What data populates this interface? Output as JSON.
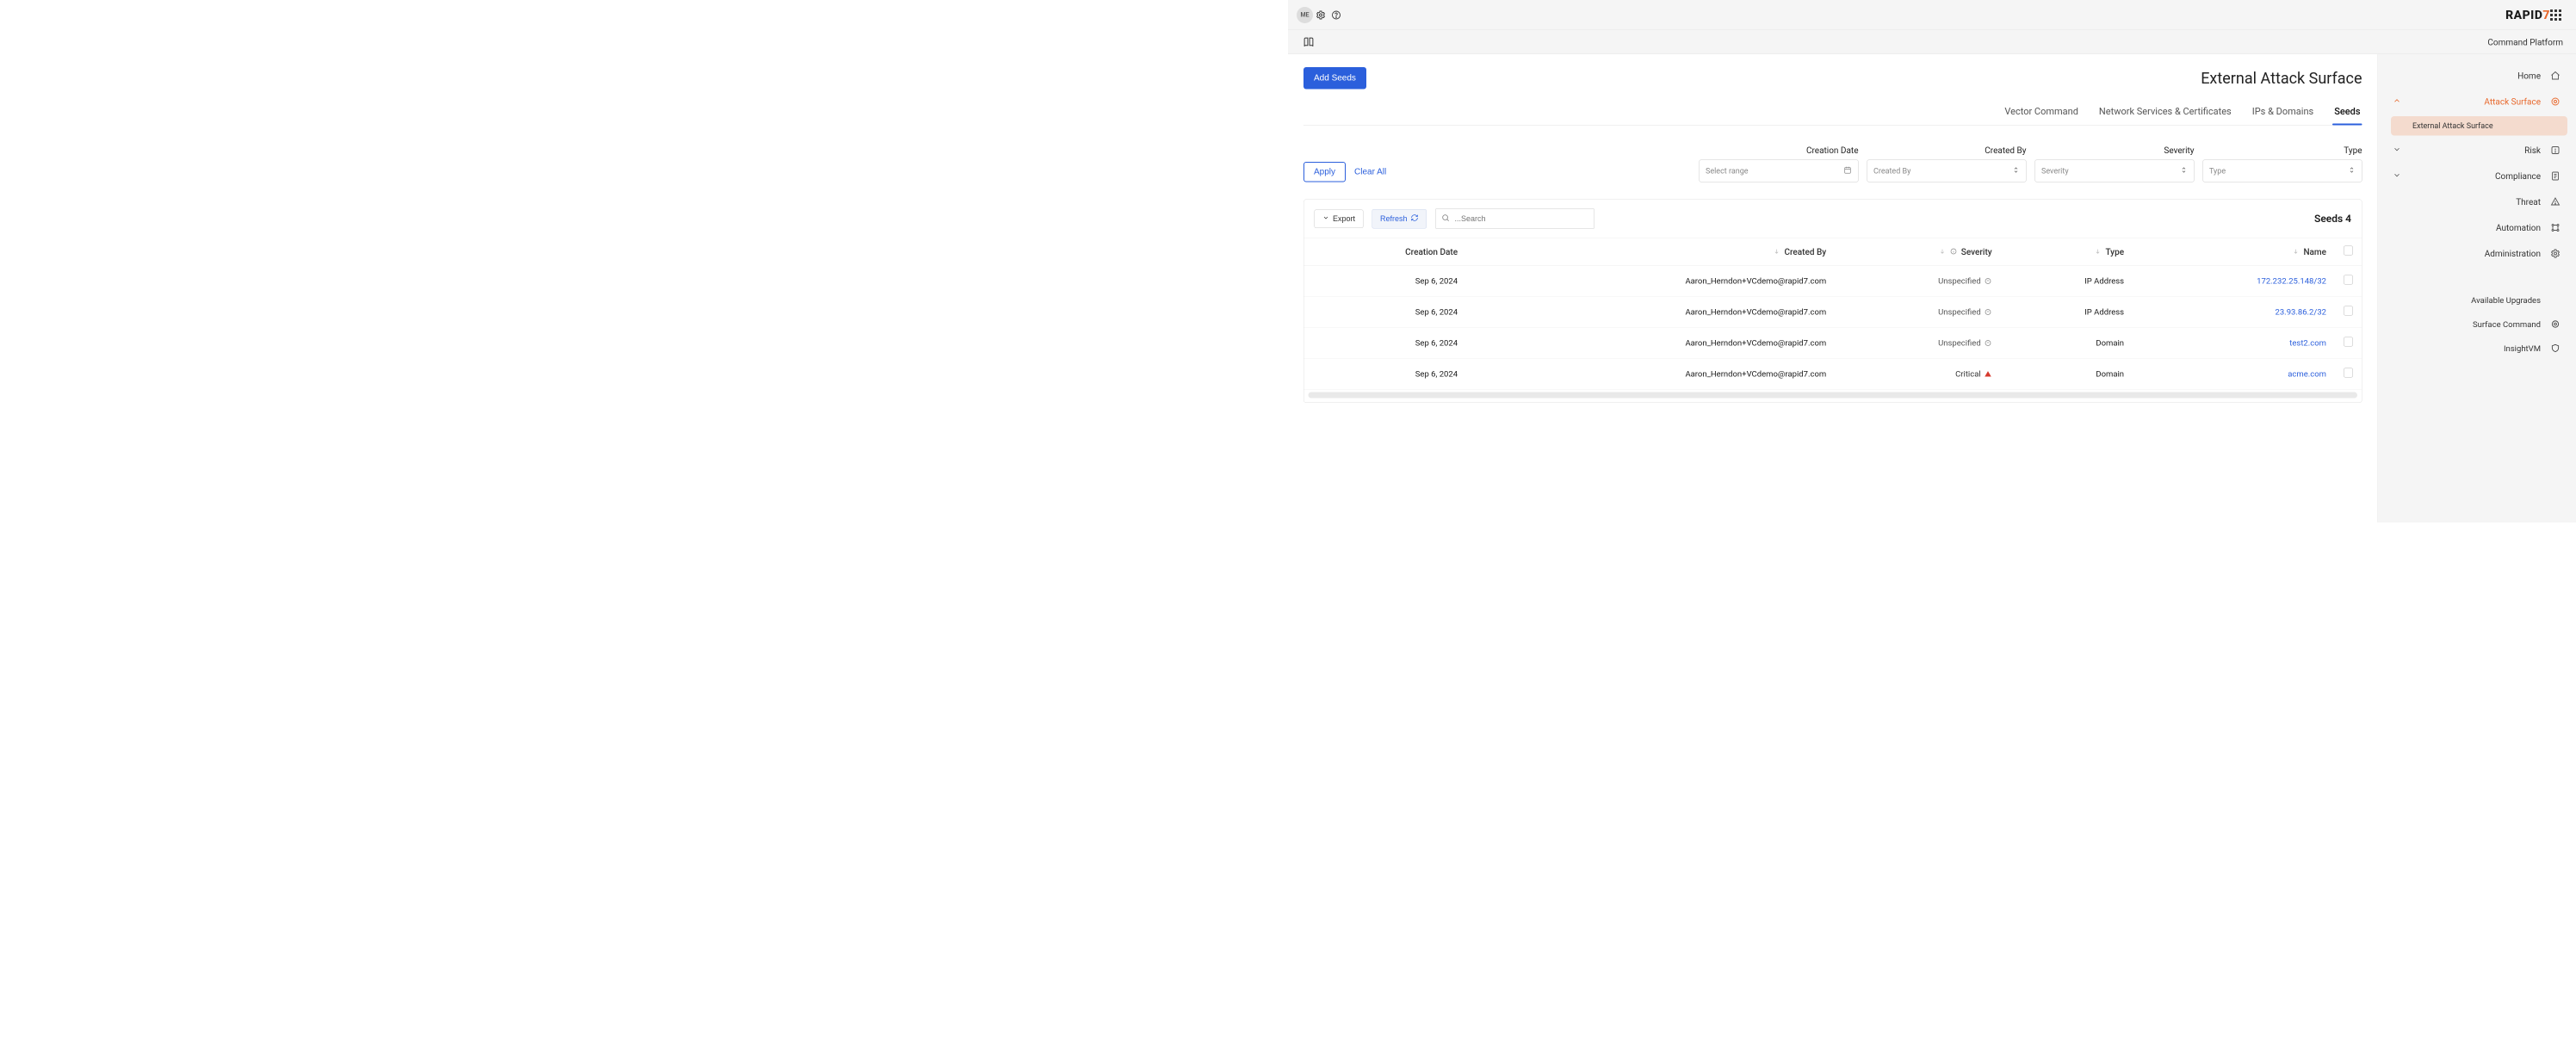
{
  "header": {
    "brand_main": "RAPID",
    "brand_accent": "7",
    "avatar_initials": "ME"
  },
  "platform_label": "Command Platform",
  "sidebar": {
    "items": [
      {
        "label": "Home"
      },
      {
        "label": "Attack Surface"
      },
      {
        "label": "Risk"
      },
      {
        "label": "Compliance"
      },
      {
        "label": "Threat"
      },
      {
        "label": "Automation"
      },
      {
        "label": "Administration"
      }
    ],
    "sub_item": "External Attack Surface",
    "secondary": [
      {
        "label": "Available Upgrades"
      },
      {
        "label": "Surface Command"
      },
      {
        "label": "InsightVM"
      }
    ]
  },
  "page": {
    "title": "External Attack Surface",
    "add_button": "Add Seeds",
    "tabs": [
      "Seeds",
      "IPs & Domains",
      "Network Services & Certificates",
      "Vector Command"
    ]
  },
  "filters": {
    "type_label": "Type",
    "type_placeholder": "Type",
    "severity_label": "Severity",
    "severity_placeholder": "Severity",
    "created_by_label": "Created By",
    "created_by_placeholder": "Created By",
    "creation_date_label": "Creation Date",
    "date_placeholder": "Select range",
    "clear_all": "Clear All",
    "apply": "Apply"
  },
  "table": {
    "count_label": "4 Seeds",
    "search_placeholder": "Search...",
    "refresh": "Refresh",
    "export": "Export",
    "columns": [
      "Name",
      "Type",
      "Severity",
      "Created By",
      "Creation Date"
    ],
    "rows": [
      {
        "name": "172.232.25.148/32",
        "type": "IP Address",
        "severity": "Unspecified",
        "created_by": "Aaron_Herndon+VCdemo@rapid7.com",
        "creation_date": "Sep 6, 2024",
        "sev_class": "unspec"
      },
      {
        "name": "23.93.86.2/32",
        "type": "IP Address",
        "severity": "Unspecified",
        "created_by": "Aaron_Herndon+VCdemo@rapid7.com",
        "creation_date": "Sep 6, 2024",
        "sev_class": "unspec"
      },
      {
        "name": "test2.com",
        "type": "Domain",
        "severity": "Unspecified",
        "created_by": "Aaron_Herndon+VCdemo@rapid7.com",
        "creation_date": "Sep 6, 2024",
        "sev_class": "unspec"
      },
      {
        "name": "acme.com",
        "type": "Domain",
        "severity": "Critical",
        "created_by": "Aaron_Herndon+VCdemo@rapid7.com",
        "creation_date": "Sep 6, 2024",
        "sev_class": "crit"
      }
    ]
  }
}
